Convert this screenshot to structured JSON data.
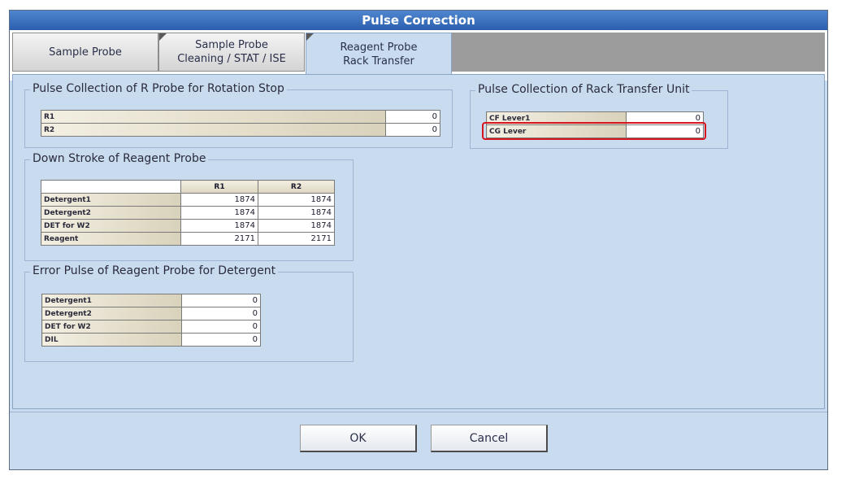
{
  "window": {
    "title": "Pulse Correction"
  },
  "tabs": [
    {
      "label": "Sample Probe"
    },
    {
      "label": "Sample Probe\nCleaning / STAT / ISE"
    },
    {
      "label": "Reagent Probe\nRack Transfer"
    }
  ],
  "rotation_stop": {
    "title": "Pulse Collection of R Probe for Rotation Stop",
    "rows": [
      {
        "label": "R1",
        "value": "0"
      },
      {
        "label": "R2",
        "value": "0"
      }
    ]
  },
  "rack_transfer": {
    "title": "Pulse Collection of Rack Transfer Unit",
    "rows": [
      {
        "label": "CF Lever1",
        "value": "0"
      },
      {
        "label": "CG Lever",
        "value": "0"
      }
    ]
  },
  "down_stroke": {
    "title": "Down Stroke of Reagent Probe",
    "columns": [
      "R1",
      "R2"
    ],
    "rows": [
      {
        "label": "Detergent1",
        "r1": "1874",
        "r2": "1874"
      },
      {
        "label": "Detergent2",
        "r1": "1874",
        "r2": "1874"
      },
      {
        "label": "DET for W2",
        "r1": "1874",
        "r2": "1874"
      },
      {
        "label": "Reagent",
        "r1": "2171",
        "r2": "2171"
      }
    ]
  },
  "error_pulse": {
    "title": "Error Pulse of Reagent Probe for Detergent",
    "rows": [
      {
        "label": "Detergent1",
        "value": "0"
      },
      {
        "label": "Detergent2",
        "value": "0"
      },
      {
        "label": "DET for W2",
        "value": "0"
      },
      {
        "label": "DIL",
        "value": "0"
      }
    ]
  },
  "buttons": {
    "ok": "OK",
    "cancel": "Cancel"
  },
  "colors": {
    "highlight": "#d8141c",
    "panel": "#c9dbef",
    "titlebar": "#2c5fae"
  }
}
